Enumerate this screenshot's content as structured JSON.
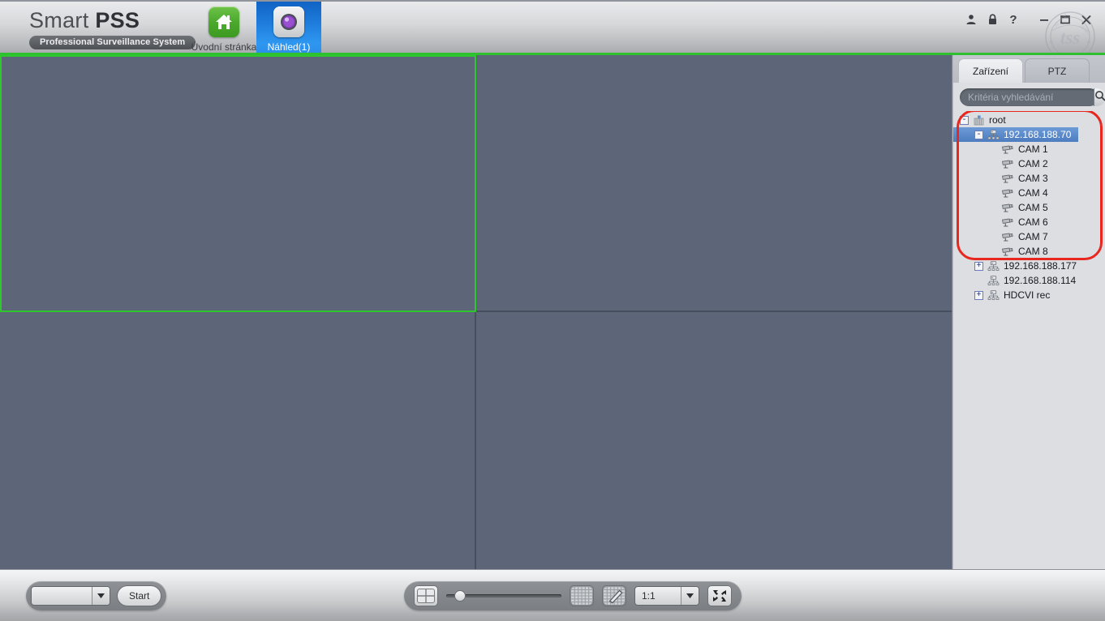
{
  "app": {
    "brand_name_light": "Smart ",
    "brand_name_bold": "PSS",
    "brand_subtitle": "Professional Surveillance System",
    "accent_green": "#2fc02f",
    "accent_blue": "#2b8de8",
    "video_panel_color": "#5d6679",
    "highlight_red": "#e8271f",
    "watermark_text": "tss",
    "watermark_ring_text": "ALARM SYSTEMS"
  },
  "nav": {
    "tabs": [
      {
        "label": "Úvodní stránka",
        "icon": "home-icon",
        "active": false
      },
      {
        "label": "Náhled(1)",
        "icon": "preview-camera-icon",
        "active": true
      }
    ]
  },
  "window_controls": [
    {
      "name": "user-icon",
      "glyph": "user"
    },
    {
      "name": "lock-icon",
      "glyph": "lock"
    },
    {
      "name": "help-icon",
      "glyph": "?"
    },
    {
      "name": "minimize-button",
      "glyph": "minimize"
    },
    {
      "name": "maximize-button",
      "glyph": "maximize"
    },
    {
      "name": "close-button",
      "glyph": "close"
    }
  ],
  "sidebar": {
    "tabs": [
      {
        "label": "Zařízení",
        "active": true
      },
      {
        "label": "PTZ",
        "active": false
      }
    ],
    "search": {
      "placeholder": "Kritéria vyhledávání",
      "value": "",
      "icon": "search-icon"
    },
    "tree": [
      {
        "label": "root",
        "depth": 0,
        "toggle": "-",
        "icon": "org-root-icon",
        "selected": false
      },
      {
        "label": "192.168.188.70",
        "depth": 1,
        "toggle": "-",
        "icon": "device-icon",
        "selected": true
      },
      {
        "label": "CAM 1",
        "depth": 2,
        "toggle": "",
        "icon": "camera-icon",
        "selected": false
      },
      {
        "label": "CAM 2",
        "depth": 2,
        "toggle": "",
        "icon": "camera-icon",
        "selected": false
      },
      {
        "label": "CAM 3",
        "depth": 2,
        "toggle": "",
        "icon": "camera-icon",
        "selected": false
      },
      {
        "label": "CAM 4",
        "depth": 2,
        "toggle": "",
        "icon": "camera-icon",
        "selected": false
      },
      {
        "label": "CAM 5",
        "depth": 2,
        "toggle": "",
        "icon": "camera-icon",
        "selected": false
      },
      {
        "label": "CAM 6",
        "depth": 2,
        "toggle": "",
        "icon": "camera-icon",
        "selected": false
      },
      {
        "label": "CAM 7",
        "depth": 2,
        "toggle": "",
        "icon": "camera-icon",
        "selected": false
      },
      {
        "label": "CAM 8",
        "depth": 2,
        "toggle": "",
        "icon": "camera-icon",
        "selected": false
      },
      {
        "label": "192.168.188.177",
        "depth": 1,
        "toggle": "+",
        "icon": "device-icon",
        "selected": false
      },
      {
        "label": "192.168.188.114",
        "depth": 1,
        "toggle": "",
        "icon": "device-icon",
        "selected": false
      },
      {
        "label": "HDCVI rec",
        "depth": 1,
        "toggle": "+",
        "icon": "device-icon",
        "selected": false
      }
    ]
  },
  "video": {
    "cells": [
      {
        "index": 0,
        "selected": true
      },
      {
        "index": 1,
        "selected": false
      },
      {
        "index": 2,
        "selected": false
      },
      {
        "index": 3,
        "selected": false
      }
    ]
  },
  "bottom_bar": {
    "stream_select": {
      "value": "",
      "arrow": "▼"
    },
    "start_button": "Start",
    "split_button_icon": "split-4-view-icon",
    "slider": {
      "value": 12,
      "min": 0,
      "max": 100
    },
    "grid_button_icon": "video-grid-icon",
    "edit_grid_button_icon": "grid-edit-pencil-icon",
    "ratio_select": {
      "value": "1:1",
      "arrow": "▼"
    },
    "fullscreen_button_icon": "fullscreen-icon"
  }
}
